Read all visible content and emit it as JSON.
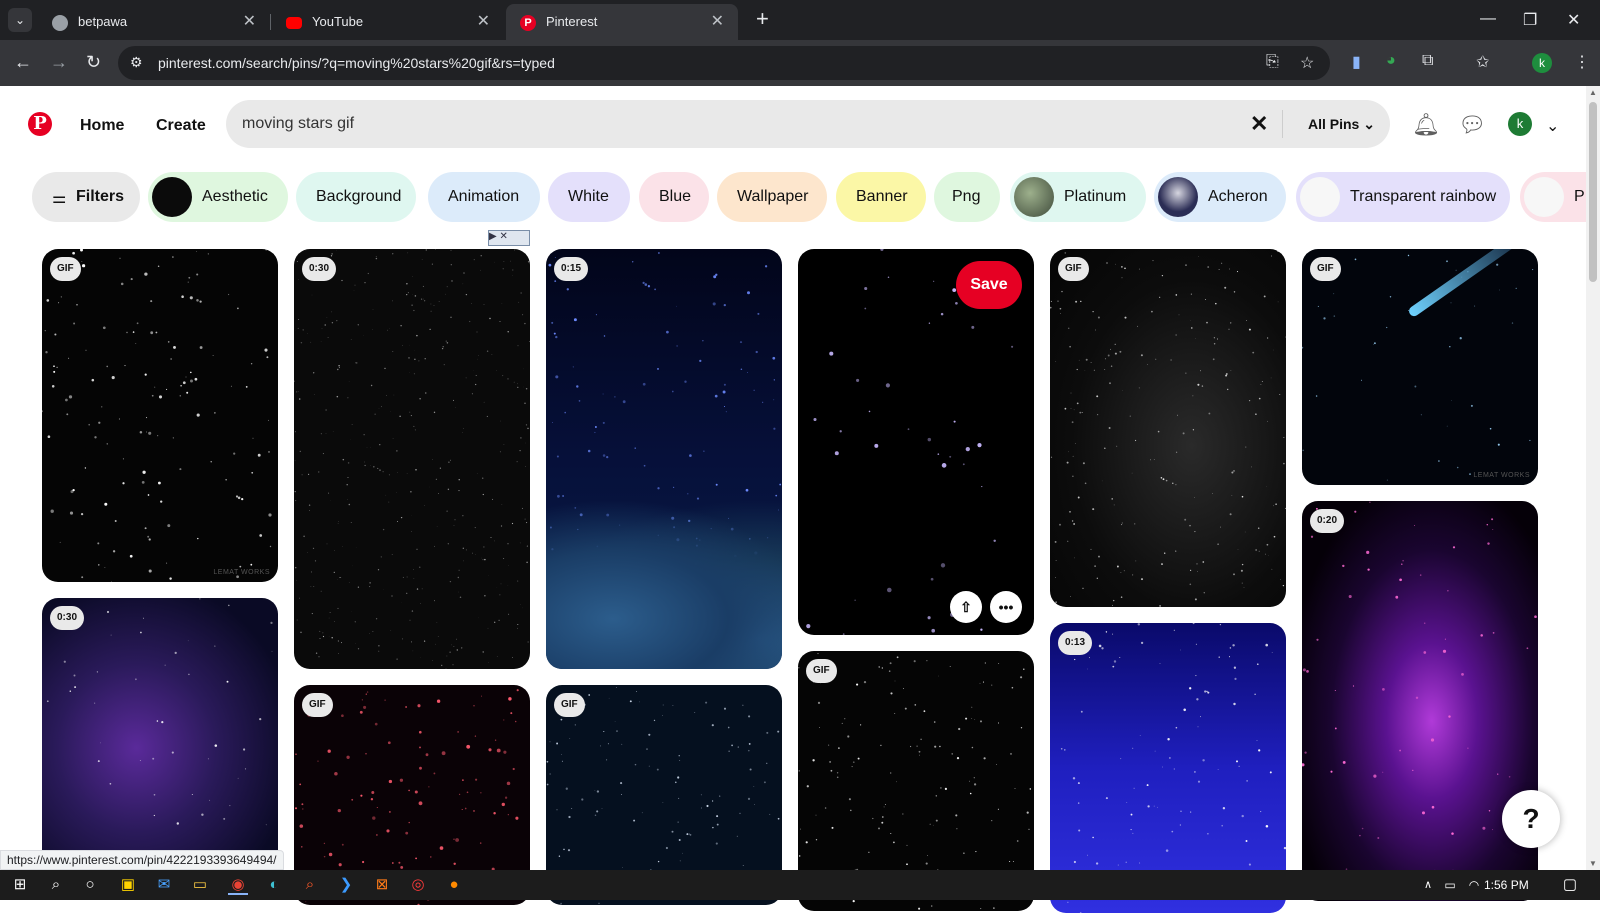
{
  "browser": {
    "tabs": [
      {
        "title": "betpawa",
        "active": false
      },
      {
        "title": "YouTube",
        "active": false
      },
      {
        "title": "Pinterest",
        "active": true
      }
    ],
    "url": "pinterest.com/search/pins/?q=moving%20stars%20gif&rs=typed",
    "profile_initial": "k"
  },
  "header": {
    "nav": {
      "home": "Home",
      "create": "Create"
    },
    "search_query": "moving stars gif",
    "scope": "All Pins",
    "avatar_initial": "k"
  },
  "filters": {
    "filters_label": "Filters",
    "chips": [
      {
        "label": "Aesthetic",
        "color": "#dff7df"
      },
      {
        "label": "Background",
        "color": "#dff7f0"
      },
      {
        "label": "Animation",
        "color": "#dcebfa"
      },
      {
        "label": "White",
        "color": "#e4e0fb"
      },
      {
        "label": "Blue",
        "color": "#fbe2e8"
      },
      {
        "label": "Wallpaper",
        "color": "#fde6cd"
      },
      {
        "label": "Banner",
        "color": "#fbf7a6"
      },
      {
        "label": "Png",
        "color": "#dff7df"
      },
      {
        "label": "Platinum",
        "color": "#dff7f0"
      },
      {
        "label": "Acheron",
        "color": "#dcebfa"
      },
      {
        "label": "Transparent rainbow",
        "color": "#e4e0fb"
      },
      {
        "label": "P",
        "color": "#fbe2e8"
      }
    ]
  },
  "pins": [
    {
      "badge": "GIF"
    },
    {
      "badge": "0:30"
    },
    {
      "badge": "0:15"
    },
    {
      "badge": ""
    },
    {
      "badge": "GIF"
    },
    {
      "badge": "GIF"
    },
    {
      "badge": "0:30"
    },
    {
      "badge": "GIF"
    },
    {
      "badge": "GIF"
    },
    {
      "badge": "GIF"
    },
    {
      "badge": "0:13"
    },
    {
      "badge": "0:20"
    }
  ],
  "hover_pin": {
    "save_label": "Save"
  },
  "watermarks": [
    "LEMAT WORKS",
    "LEMAT WORKS"
  ],
  "help_label": "?",
  "status_bar_url": "https://www.pinterest.com/pin/4222193393649494/",
  "taskbar": {
    "time": "1:56 PM"
  }
}
